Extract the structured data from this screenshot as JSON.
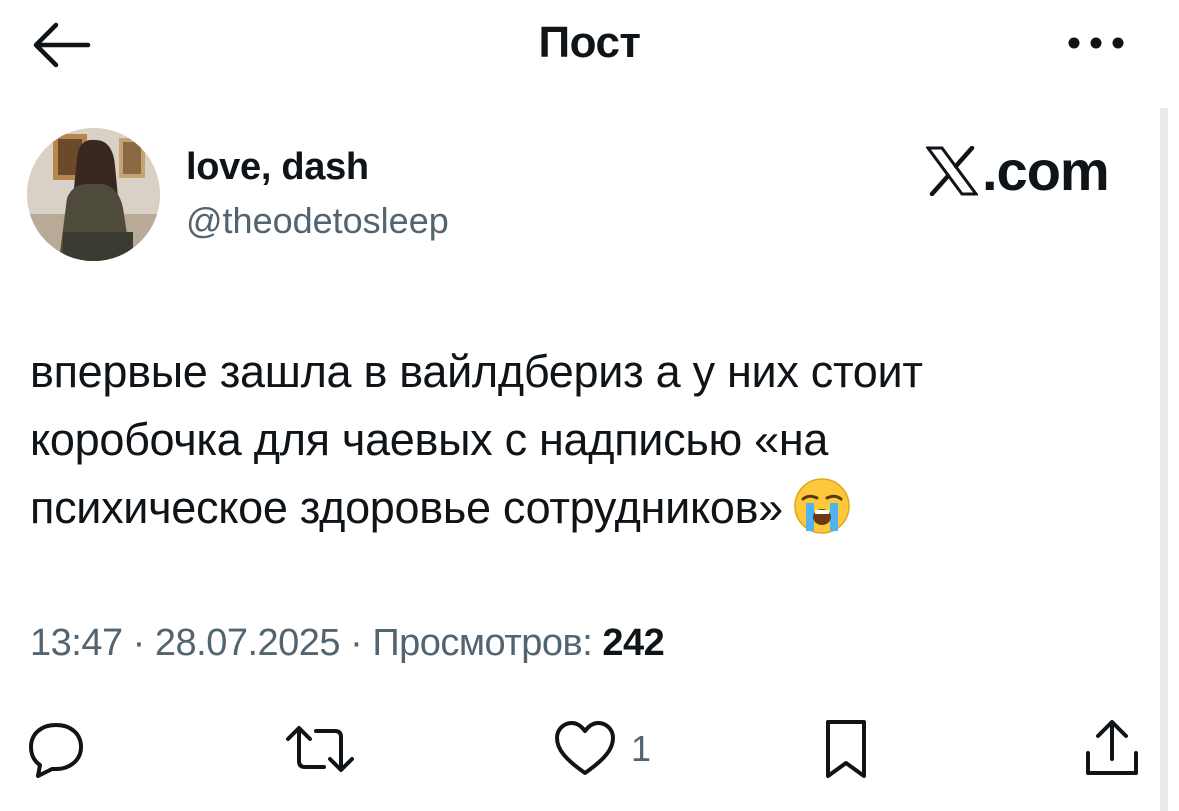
{
  "header": {
    "title": "Пост",
    "back_icon": "arrow-left-icon",
    "more_icon": "more-horizontal-icon"
  },
  "author": {
    "display_name": "love, dash",
    "handle": "@theodetosleep",
    "avatar_icon": "profile-photo"
  },
  "brand": {
    "label": ".com",
    "logo_icon": "x-logo-icon"
  },
  "post": {
    "lines": [
      "впервые зашла в вайлдбериз а у них стоит",
      "коробочка для чаевых с надписью «на",
      "психическое здоровье сотрудников»"
    ],
    "emoji": "loudly-crying-face-emoji"
  },
  "meta": {
    "time": "13:47",
    "separator": "·",
    "date": "28.07.2025",
    "views_label": "Просмотров:",
    "views_count": "242"
  },
  "actions": {
    "reply_icon": "reply-bubble-icon",
    "repost_icon": "repost-icon",
    "like_icon": "heart-icon",
    "like_count": "1",
    "bookmark_icon": "bookmark-icon",
    "share_icon": "share-icon"
  },
  "colors": {
    "text": "#0f1419",
    "secondary": "#536471",
    "background": "#ffffff"
  }
}
